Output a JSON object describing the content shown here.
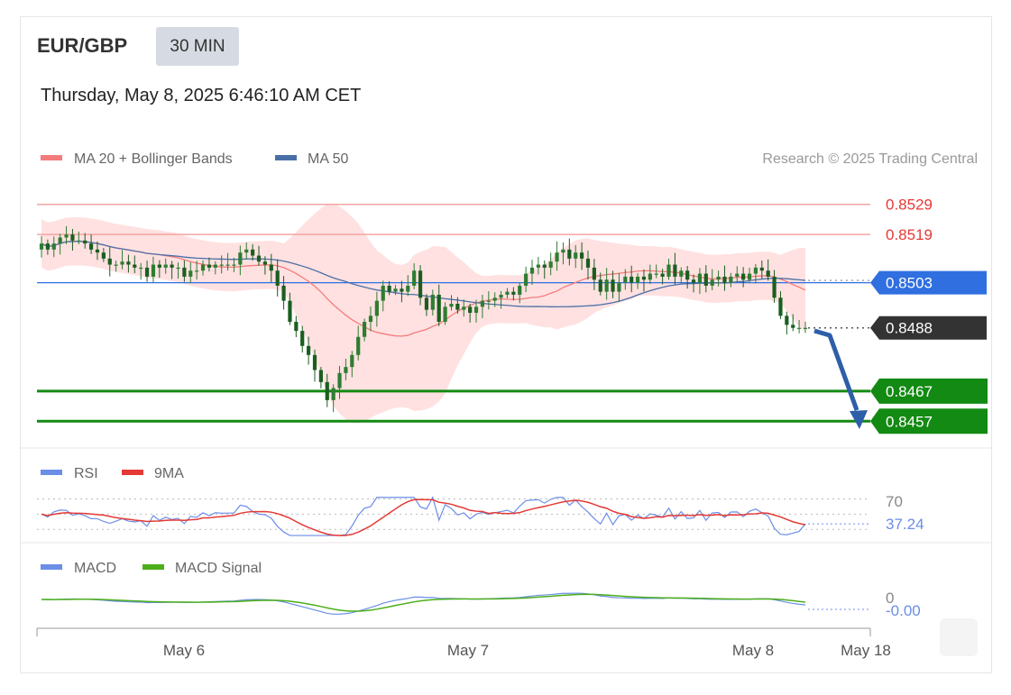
{
  "header": {
    "pair": "EUR/GBP",
    "timeframe": "30 MIN",
    "datetime": "Thursday, May 8, 2025 6:46:10 AM CET",
    "credit": "Research © 2025 Trading Central"
  },
  "colors": {
    "ma20": "#f47c7c",
    "band_fill": "#ffdcdc",
    "ma50": "#4a6fa8",
    "bull": "#2e7d32",
    "bear": "#1b5e20",
    "resistance": "#f4a4a4",
    "pivot": "#2f6fe0",
    "support": "#138a13",
    "last_price_tag": "#333333",
    "forecast_arrow": "#2d5ea8",
    "rsi": "#6b8ee6",
    "rsi_ma": "#e53935",
    "macd": "#6b8ee6",
    "macd_signal": "#4caf1a"
  },
  "chart_data": [
    {
      "type": "candlestick",
      "panel": "price",
      "legend": [
        "MA 20 + Bollinger Bands",
        "MA 50"
      ],
      "ylim": [
        0.8452,
        0.8537
      ],
      "x_ticks": [
        "May 6",
        "May 7",
        "May 8",
        "May 18"
      ],
      "levels": [
        {
          "label": "0.8529",
          "value": 0.8529,
          "kind": "resistance"
        },
        {
          "label": "0.8519",
          "value": 0.8519,
          "kind": "resistance"
        },
        {
          "label": "0.8503",
          "value": 0.8503,
          "kind": "pivot"
        },
        {
          "label": "0.8488",
          "value": 0.8488,
          "kind": "last"
        },
        {
          "label": "0.8467",
          "value": 0.8467,
          "kind": "support"
        },
        {
          "label": "0.8457",
          "value": 0.8457,
          "kind": "support"
        }
      ],
      "forecast": {
        "from": 0.8488,
        "to": 0.8457,
        "direction": "down"
      },
      "close": [
        0.8516,
        0.8514,
        0.8516,
        0.8518,
        0.8519,
        0.8517,
        0.8517,
        0.8516,
        0.8514,
        0.8513,
        0.8511,
        0.8509,
        0.8509,
        0.851,
        0.8509,
        0.8508,
        0.8508,
        0.8505,
        0.8509,
        0.8508,
        0.8509,
        0.8508,
        0.8508,
        0.8505,
        0.8507,
        0.8507,
        0.8509,
        0.8508,
        0.8509,
        0.8509,
        0.8509,
        0.8509,
        0.8513,
        0.8514,
        0.8512,
        0.851,
        0.8509,
        0.8507,
        0.8502,
        0.8497,
        0.849,
        0.8487,
        0.8482,
        0.8479,
        0.8474,
        0.847,
        0.8464,
        0.8468,
        0.8473,
        0.8475,
        0.8479,
        0.8485,
        0.849,
        0.8492,
        0.8497,
        0.8502,
        0.85,
        0.8501,
        0.85,
        0.8502,
        0.8507,
        0.8498,
        0.8494,
        0.8499,
        0.849,
        0.8495,
        0.8496,
        0.8494,
        0.8495,
        0.8493,
        0.8495,
        0.8497,
        0.8497,
        0.8498,
        0.8499,
        0.85,
        0.8499,
        0.8502,
        0.8506,
        0.8508,
        0.8509,
        0.8508,
        0.851,
        0.8513,
        0.8514,
        0.8511,
        0.8513,
        0.8511,
        0.8508,
        0.8504,
        0.85,
        0.8504,
        0.85,
        0.8503,
        0.8505,
        0.8503,
        0.8505,
        0.8504,
        0.8506,
        0.8506,
        0.8505,
        0.8509,
        0.8505,
        0.8507,
        0.8504,
        0.8503,
        0.8506,
        0.8502,
        0.8504,
        0.8505,
        0.8503,
        0.8505,
        0.8506,
        0.8504,
        0.8506,
        0.8508,
        0.8507,
        0.8505,
        0.8498,
        0.8492,
        0.8489,
        0.8488,
        0.8488,
        0.8488
      ]
    },
    {
      "type": "line",
      "panel": "rsi",
      "series": [
        {
          "name": "RSI"
        },
        {
          "name": "9MA"
        }
      ],
      "level": {
        "label": "70",
        "value": 70
      },
      "last": {
        "label": "37.24",
        "value": 37.24
      },
      "ylim": [
        15,
        80
      ]
    },
    {
      "type": "line",
      "panel": "macd",
      "series": [
        {
          "name": "MACD"
        },
        {
          "name": "MACD Signal"
        }
      ],
      "ticks": [
        "0"
      ],
      "last": {
        "label": "-0.00",
        "value": 0
      }
    }
  ]
}
